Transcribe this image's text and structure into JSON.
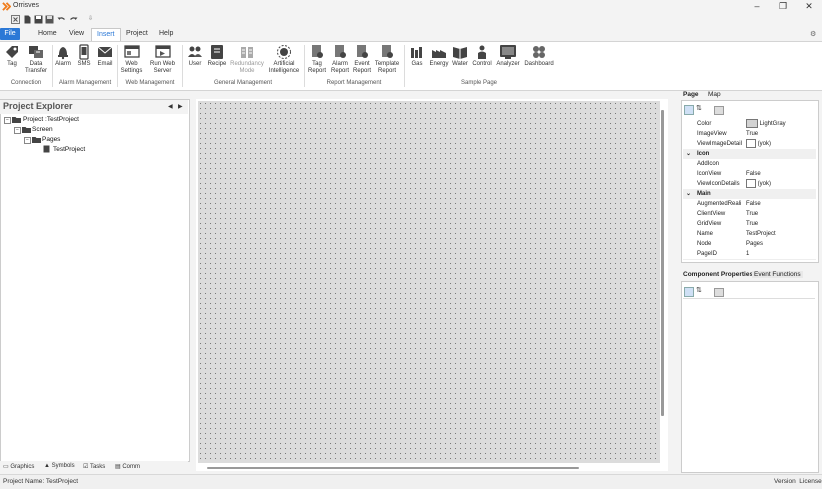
{
  "app": {
    "title": "Orrisves",
    "window_buttons": [
      "–",
      "❐",
      "✕"
    ]
  },
  "quick_access": [
    "close-icon",
    "new-icon",
    "save-icon",
    "save-all-icon",
    "undo-icon",
    "redo-icon"
  ],
  "ribbon": {
    "tabs": [
      {
        "label": "File",
        "kind": "file"
      },
      {
        "label": "Home",
        "kind": "normal"
      },
      {
        "label": "View",
        "kind": "normal"
      },
      {
        "label": "Insert",
        "kind": "active"
      },
      {
        "label": "Project",
        "kind": "normal"
      },
      {
        "label": "Help",
        "kind": "normal"
      }
    ],
    "buttons": [
      {
        "label": "Tag",
        "icon": "tag-icon"
      },
      {
        "label": "Data Transfer",
        "icon": "data-transfer-icon"
      },
      {
        "label": "Alarm",
        "icon": "alarm-icon"
      },
      {
        "label": "SMS",
        "icon": "sms-icon"
      },
      {
        "label": "Email",
        "icon": "email-icon"
      },
      {
        "label": "Web Settings",
        "icon": "web-settings-icon"
      },
      {
        "label": "Run Web Server",
        "icon": "web-server-icon"
      },
      {
        "label": "User",
        "icon": "user-icon"
      },
      {
        "label": "Recipe",
        "icon": "recipe-icon"
      },
      {
        "label": "Redundancy Mode",
        "icon": "redundancy-icon"
      },
      {
        "label": "Artificial Intelligence",
        "icon": "ai-icon"
      },
      {
        "label": "Tag Report",
        "icon": "tag-report-icon"
      },
      {
        "label": "Alarm Report",
        "icon": "alarm-report-icon"
      },
      {
        "label": "Event Report",
        "icon": "event-report-icon"
      },
      {
        "label": "Template Report",
        "icon": "template-report-icon"
      },
      {
        "label": "Gas",
        "icon": "gas-icon"
      },
      {
        "label": "Energy",
        "icon": "energy-icon"
      },
      {
        "label": "Water",
        "icon": "water-icon"
      },
      {
        "label": "Control",
        "icon": "control-icon"
      },
      {
        "label": "Analyzer",
        "icon": "analyzer-icon"
      },
      {
        "label": "Dashboard",
        "icon": "dashboard-icon"
      }
    ],
    "groups": [
      "Connection",
      "Alarm Management",
      "Web Management",
      "General Management",
      "Report Management",
      "Sample Page"
    ]
  },
  "explorer": {
    "title": "Project Explorer",
    "tree": [
      {
        "label": "Project :TestProject",
        "icon": "project-folder-icon"
      },
      {
        "label": "Screen",
        "icon": "screen-folder-icon"
      },
      {
        "label": "Pages",
        "icon": "pages-folder-icon"
      },
      {
        "label": "TestProject",
        "icon": "page-icon"
      }
    ],
    "bottom_tabs": [
      {
        "label": "Graphics",
        "icon": "graphics-icon"
      },
      {
        "label": "Symbols",
        "icon": "symbols-icon"
      },
      {
        "label": "Tasks",
        "icon": "tasks-icon"
      },
      {
        "label": "Comm",
        "icon": "comm-icon"
      }
    ]
  },
  "properties": {
    "tabs": [
      "Page",
      "Map"
    ],
    "rows": [
      {
        "key": "Color",
        "value": "LightGray",
        "swatch": "#d3d3d3"
      },
      {
        "key": "ImageView",
        "value": "True"
      },
      {
        "key": "ViewImageDetail",
        "value": "(yok)",
        "swatch": "#ffffff"
      },
      {
        "key": "Icon",
        "category": true
      },
      {
        "key": "AddIcon",
        "value": ""
      },
      {
        "key": "IconView",
        "value": "False"
      },
      {
        "key": "ViewIconDetails",
        "value": "(yok)",
        "swatch": "#ffffff"
      },
      {
        "key": "Main",
        "category": true
      },
      {
        "key": "AugmentedReali",
        "value": "False"
      },
      {
        "key": "ClientView",
        "value": "True"
      },
      {
        "key": "GridView",
        "value": "True"
      },
      {
        "key": "Name",
        "value": "TestProject"
      },
      {
        "key": "Node",
        "value": "Pages"
      },
      {
        "key": "PageID",
        "value": "1"
      }
    ]
  },
  "component": {
    "tabs": [
      "Component Properties",
      "Event Functions"
    ]
  },
  "status": {
    "project": "Project Name: TestProject",
    "right": "Version  License"
  }
}
